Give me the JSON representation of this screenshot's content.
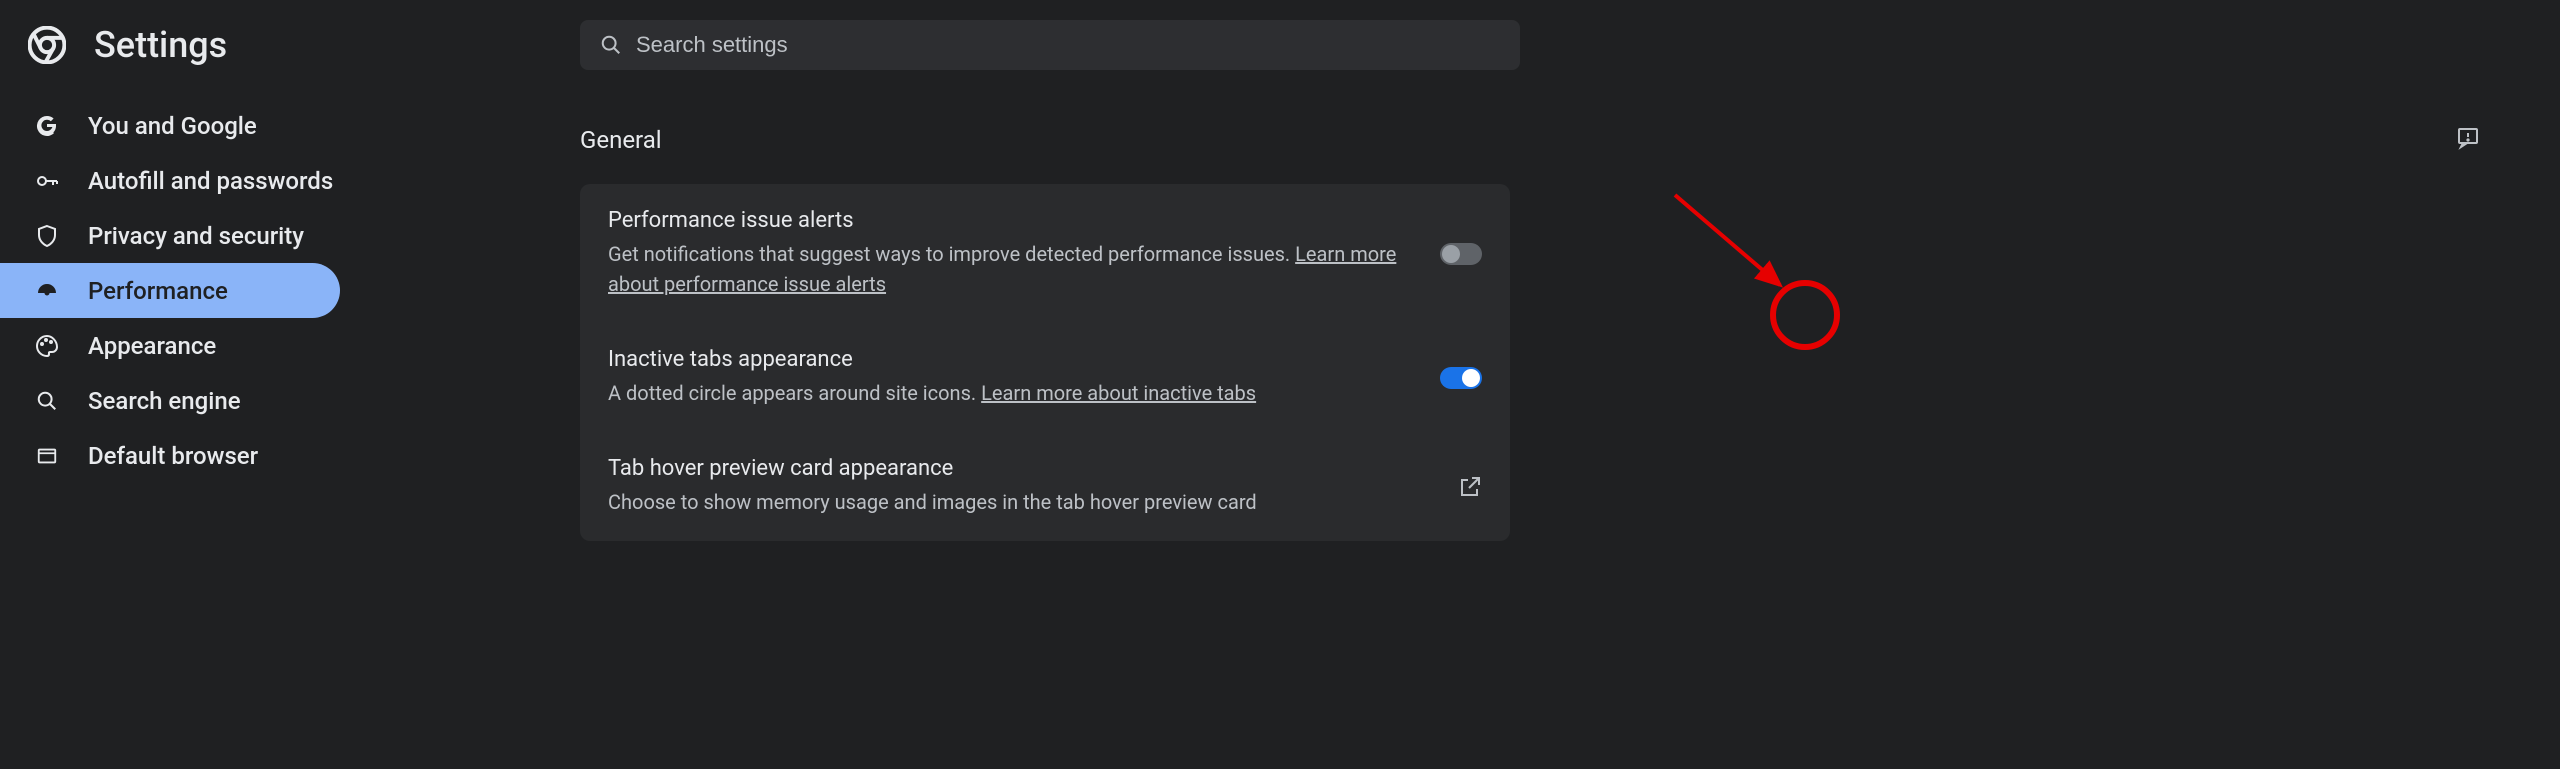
{
  "header": {
    "title": "Settings"
  },
  "search": {
    "placeholder": "Search settings"
  },
  "sidebar": {
    "items": [
      {
        "label": "You and Google"
      },
      {
        "label": "Autofill and passwords"
      },
      {
        "label": "Privacy and security"
      },
      {
        "label": "Performance"
      },
      {
        "label": "Appearance"
      },
      {
        "label": "Search engine"
      },
      {
        "label": "Default browser"
      }
    ]
  },
  "main": {
    "section_title": "General",
    "settings": [
      {
        "title": "Performance issue alerts",
        "desc": "Get notifications that suggest ways to improve detected performance issues. ",
        "link": "Learn more about performance issue alerts",
        "toggle": "off"
      },
      {
        "title": "Inactive tabs appearance",
        "desc": "A dotted circle appears around site icons. ",
        "link": "Learn more about inactive tabs",
        "toggle": "on"
      },
      {
        "title": "Tab hover preview card appearance",
        "desc": "Choose to show memory usage and images in the tab hover preview card",
        "link": "",
        "toggle": ""
      }
    ]
  }
}
